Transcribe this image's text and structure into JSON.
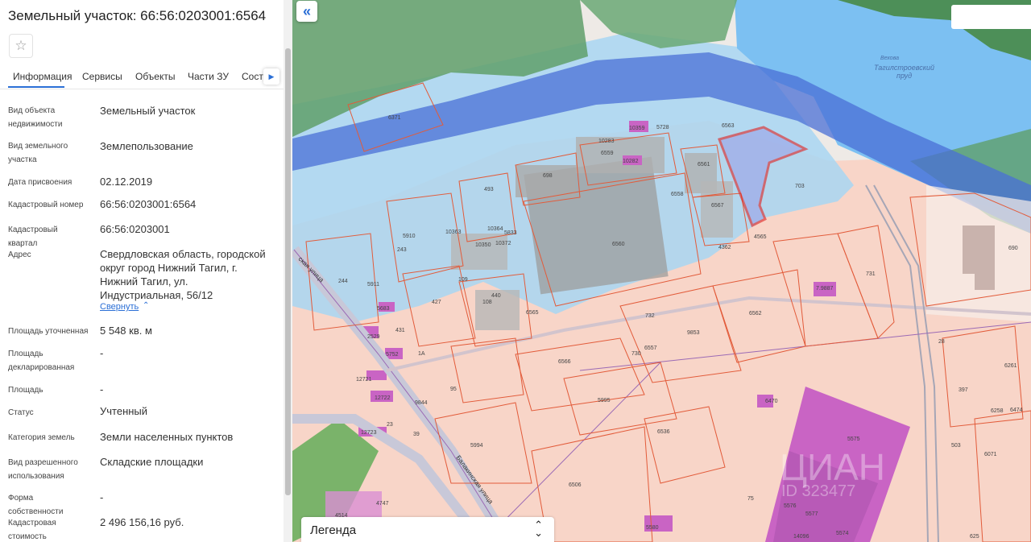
{
  "header": {
    "title": "Земельный участок: 66:56:0203001:6564",
    "favorite_icon": "☆"
  },
  "tabs": [
    "Информация",
    "Сервисы",
    "Объекты",
    "Части ЗУ",
    "Соста"
  ],
  "fields": [
    {
      "label": "Вид объекта недвижимости",
      "value": "Земельный участок"
    },
    {
      "label": "Вид земельного участка",
      "value": "Землепользование"
    },
    {
      "label": "Дата присвоения",
      "value": "02.12.2019"
    },
    {
      "label": "Кадастровый номер",
      "value": "66:56:0203001:6564"
    },
    {
      "label": "Кадастровый квартал",
      "value": "66:56:0203001"
    },
    {
      "label": "Адрес",
      "value": "Свердловская область, городской округ город Нижний Тагил, г. Нижний Тагил, ул. Индустриальная, 56/12"
    },
    {
      "label": "Площадь уточненная",
      "value": "5 548 кв. м"
    },
    {
      "label": "Площадь декларированная",
      "value": "-"
    },
    {
      "label": "Площадь",
      "value": "-"
    },
    {
      "label": "Статус",
      "value": "Учтенный"
    },
    {
      "label": "Категория земель",
      "value": "Земли населенных пунктов"
    },
    {
      "label": "Вид разрешенного использования",
      "value": "Складские площадки"
    },
    {
      "label": "Форма собственности",
      "value": "-"
    },
    {
      "label": "Кадастровая стоимость",
      "value": "2 496 156,16 руб."
    }
  ],
  "address_toggle": {
    "label": "Свернуть",
    "icon": "chevron-up-icon"
  },
  "map": {
    "collapse_icon": "«",
    "legend_label": "Легенда",
    "water_label_1": "Вехова",
    "water_label_2": "Тагилстроевский",
    "water_label_3": "пруд",
    "street_1": "Балакинская улица",
    "street_2": "Балакинская улица",
    "street_3": "Балакинская улица",
    "street_4": "Балакинская улица",
    "street_left": "ская улица",
    "street_bottom": "Балакинская улица",
    "watermark": "ЦИАН",
    "watermark_id": "ID 323477",
    "parcels": [
      "6371",
      "10359",
      "5728",
      "6563",
      "10283",
      "6559",
      "10282",
      "698",
      "6561",
      "6558",
      "6567",
      "703",
      "4362",
      "4565",
      "493",
      "5910",
      "10363",
      "5833",
      "10350",
      "10372",
      "10364",
      "6560",
      "243",
      "109",
      "244",
      "5911",
      "440",
      "108",
      "427",
      "6565",
      "5683",
      "431",
      "2529",
      "5752",
      "1А",
      "732",
      "730",
      "6557",
      "9853",
      "6562",
      "7.9887",
      "731",
      "690",
      "6566",
      "95",
      "5995",
      "9844",
      "12721",
      "12722",
      "23",
      "39",
      "12723",
      "5994",
      "6536",
      "6470",
      "5575",
      "6506",
      "75",
      "5576",
      "5577",
      "5574",
      "14096",
      "5580",
      "4747",
      "4514",
      "397",
      "503",
      "6261",
      "6258",
      "6474",
      "6071",
      "625",
      "28"
    ],
    "colors": {
      "forest": "#5f9f6a",
      "water": "#8dc4f0",
      "river_band": "#4a6fd6",
      "parcel_fill": "#f9d8cd",
      "parcel_line": "#e25b3a",
      "building": "#b4b4b4",
      "magenta": "#c964c4",
      "selected": "#e0201f"
    }
  }
}
